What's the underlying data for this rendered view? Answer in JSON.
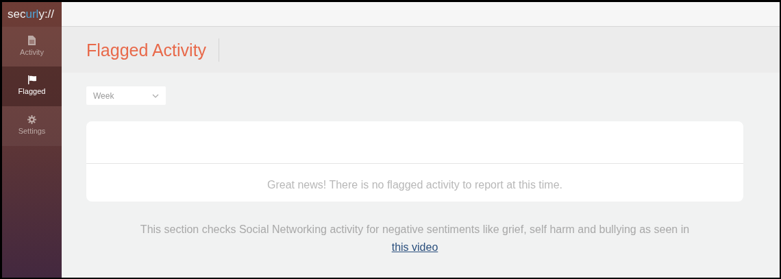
{
  "logo": {
    "parts": [
      {
        "text": "sec",
        "accent": false
      },
      {
        "text": "url",
        "accent": true
      },
      {
        "text": "y://",
        "accent": false
      }
    ]
  },
  "sidebar": {
    "items": [
      {
        "label": "Activity",
        "selected": false
      },
      {
        "label": "Flagged",
        "selected": true
      },
      {
        "label": "Settings",
        "selected": false
      }
    ]
  },
  "page_title": "Flagged Activity",
  "period_select": {
    "value": "Week"
  },
  "card": {
    "message": "Great news! There is no flagged activity to report at this time."
  },
  "info": {
    "text": "This section checks Social Networking activity for negative sentiments like grief, self harm and bullying as seen in",
    "link": "this video"
  }
}
